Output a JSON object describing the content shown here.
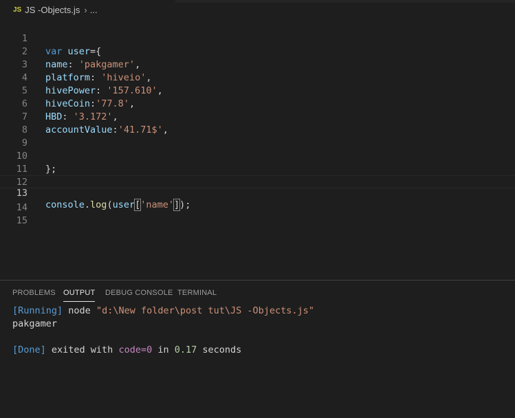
{
  "breadcrumb": {
    "badge": "JS",
    "file": "JS -Objects.js",
    "chevron": "›",
    "rest": "..."
  },
  "editor": {
    "line_numbers": [
      "1",
      "2",
      "3",
      "4",
      "5",
      "6",
      "7",
      "8",
      "9",
      "10",
      "11",
      "12",
      "13",
      "14",
      "15"
    ],
    "active_line": "13",
    "tokens": {
      "l1_kw": "var",
      "l1_var": "user",
      "l1_rest": "={",
      "l2_key": "name",
      "l2_sep": ": ",
      "l2_val": "'pakgamer'",
      "l2_end": ",",
      "l3_key": "platform",
      "l3_sep": ": ",
      "l3_val": "'hiveio'",
      "l3_end": ",",
      "l4_key": "hivePower",
      "l4_sep": ": ",
      "l4_val": "'157.610'",
      "l4_end": ",",
      "l5_key": "hiveCoin",
      "l5_sep": ":",
      "l5_val": "'77.8'",
      "l5_end": ",",
      "l6_key": "HBD",
      "l6_sep": ": ",
      "l6_val": "'3.172'",
      "l6_end": ",",
      "l7_key": "accountValue",
      "l7_sep": ":",
      "l7_val": "'41.71$'",
      "l7_end": ",",
      "l10": "};",
      "l13_obj": "console",
      "l13_dot": ".",
      "l13_fn": "log",
      "l13_open": "(",
      "l13_var": "user",
      "l13_lb": "[",
      "l13_str": "'name'",
      "l13_rb": "]",
      "l13_close": ");"
    }
  },
  "panel": {
    "tabs": [
      "PROBLEMS",
      "OUTPUT",
      "DEBUG CONSOLE",
      "TERMINAL"
    ],
    "active_tab": "OUTPUT",
    "output": {
      "running_tag": "[Running]",
      "running_cmd": " node ",
      "running_path": "\"d:\\New folder\\post tut\\JS -Objects.js\"",
      "result": "pakgamer",
      "done_tag": "[Done]",
      "done_text1": " exited with ",
      "done_code": "code=0",
      "done_text2": " in ",
      "done_num": "0.17",
      "done_text3": " seconds"
    }
  }
}
